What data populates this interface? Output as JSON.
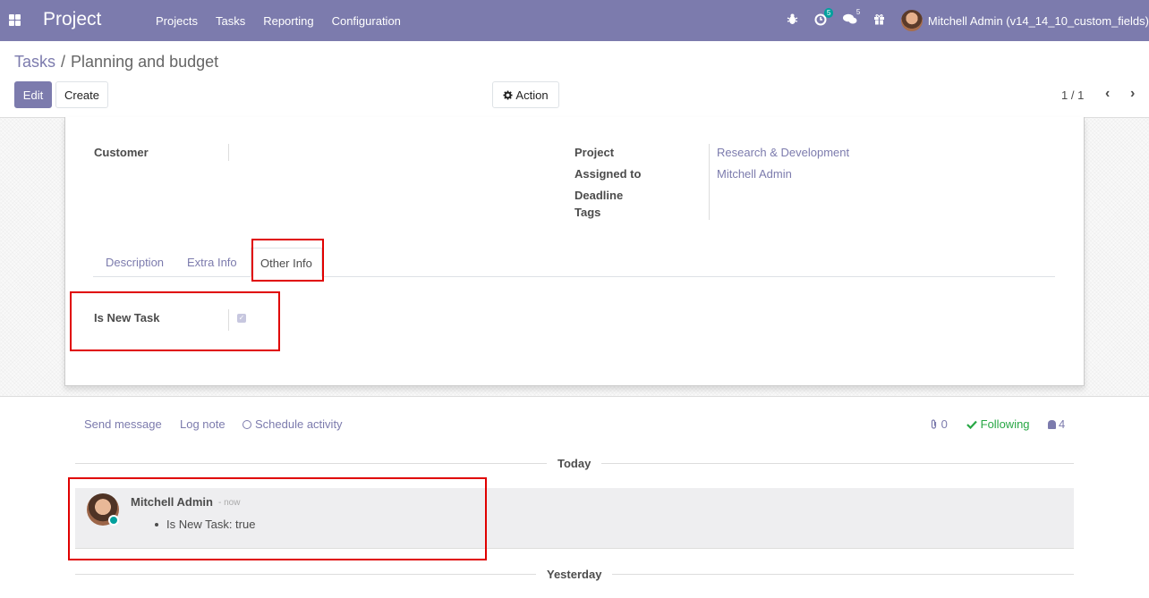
{
  "navbar": {
    "brand": "Project",
    "menu": [
      "Projects",
      "Tasks",
      "Reporting",
      "Configuration"
    ],
    "activity_count": "5",
    "messages_count": "5",
    "user": "Mitchell Admin (v14_14_10_custom_fields)",
    "icons": [
      "apps-icon",
      "bug-icon",
      "activity-clock-icon",
      "messages-icon",
      "gift-icon"
    ]
  },
  "breadcrumb": {
    "parent": "Tasks",
    "separator": "/",
    "current": "Planning and budget"
  },
  "buttons": {
    "edit": "Edit",
    "create": "Create",
    "action": "Action"
  },
  "pager": {
    "value": "1 / 1",
    "prev": "‹",
    "next": "›"
  },
  "form": {
    "customer_label": "Customer",
    "project_label": "Project",
    "project_value": "Research & Development",
    "assigned_label": "Assigned to",
    "assigned_value": "Mitchell Admin",
    "deadline_label": "Deadline",
    "tags_label": "Tags",
    "tabs": [
      "Description",
      "Extra Info",
      "Other Info"
    ],
    "active_tab": "Other Info",
    "is_new_task_label": "Is New Task",
    "is_new_task": true
  },
  "chatter": {
    "send_message": "Send message",
    "log_note": "Log note",
    "schedule_activity": "Schedule activity",
    "attachments_count": "0",
    "following": "Following",
    "followers_count": "4",
    "today": "Today",
    "yesterday": "Yesterday",
    "message": {
      "author": "Mitchell Admin",
      "date": "- now",
      "tracking": "Is New Task: true"
    }
  },
  "colors": {
    "brand": "#7c7bad",
    "following": "#28a745",
    "online": "#00a09d",
    "highlight": "#e00000"
  }
}
